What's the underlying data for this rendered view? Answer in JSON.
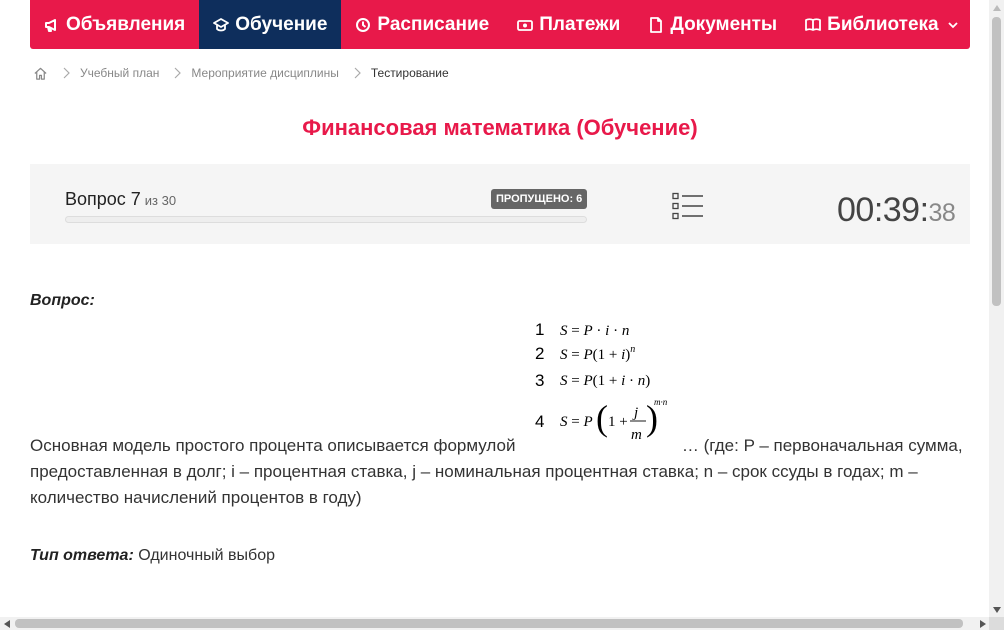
{
  "nav": {
    "items": [
      {
        "label": "Объявления",
        "icon": "megaphone-icon",
        "active": false
      },
      {
        "label": "Обучение",
        "icon": "graduation-cap-icon",
        "active": true
      },
      {
        "label": "Расписание",
        "icon": "clock-icon",
        "active": false
      },
      {
        "label": "Платежи",
        "icon": "money-icon",
        "active": false
      },
      {
        "label": "Документы",
        "icon": "document-icon",
        "active": false
      },
      {
        "label": "Библиотека",
        "icon": "book-icon",
        "active": false,
        "dropdown": true
      }
    ],
    "accent_color": "#e8194a",
    "active_color": "#0e2e5c"
  },
  "breadcrumb": {
    "items": [
      "Учебный план",
      "Мероприятие дисциплины"
    ],
    "current": "Тестирование"
  },
  "page_title": "Финансовая математика (Обучение)",
  "question_panel": {
    "question_label": "Вопрос 7",
    "of_total": "из 30",
    "skipped_badge": "ПРОПУЩЕНО: 6",
    "progress_fraction": 0.0,
    "timer_main": "00:39:",
    "timer_seconds": "38"
  },
  "question": {
    "heading": "Вопрос:",
    "text_before": "Основная модель простого процента описывается формулой",
    "text_after": "… (где: P – первоначальная сумма, предоставленная в долг; i – процентная ставка, j – номинальная процентная ставка; n – срок ссуды в годах; m – количество начислений процентов в году)",
    "formula_options": [
      {
        "number": "1",
        "formula": "S = P · i · n"
      },
      {
        "number": "2",
        "formula": "S = P(1 + i)^n"
      },
      {
        "number": "3",
        "formula": "S = P(1 + i · n)"
      },
      {
        "number": "4",
        "formula": "S = P(1 + j/m)^(m·n)"
      }
    ]
  },
  "answer_type": {
    "label": "Тип ответа:",
    "value": "Одиночный выбор"
  }
}
